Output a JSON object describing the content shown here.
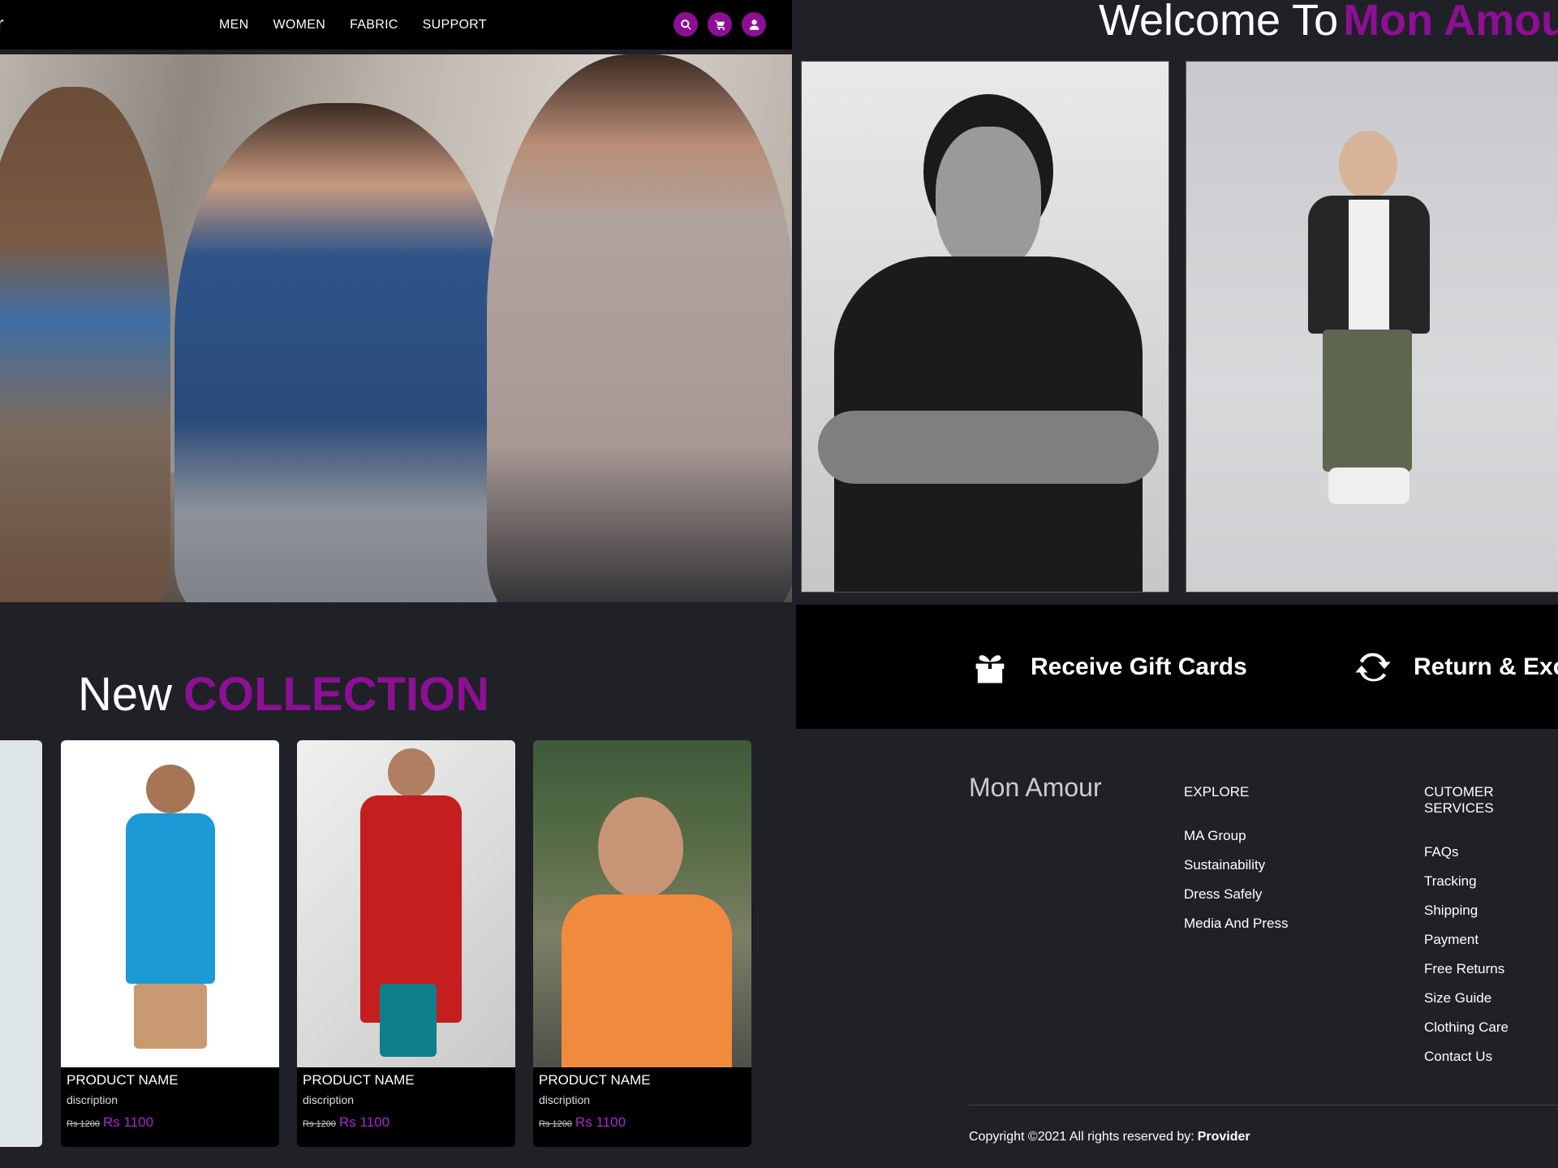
{
  "left": {
    "nav": {
      "logo_fragment": "r",
      "links": [
        "MEN",
        "WOMEN",
        "FABRIC",
        "SUPPORT"
      ],
      "icons": [
        "search-icon",
        "cart-icon",
        "user-icon"
      ],
      "accent_color": "#8c0f94"
    },
    "collection": {
      "title_thin": "New",
      "title_bold": "COLLECTION"
    },
    "products": [
      {
        "name": "PRODUCT NAME",
        "description": "discription",
        "old_price": "Rs 1200",
        "price": "Rs 1100"
      },
      {
        "name": "PRODUCT NAME",
        "description": "discription",
        "old_price": "Rs 1200",
        "price": "Rs 1100"
      },
      {
        "name": "PRODUCT NAME",
        "description": "discription",
        "old_price": "Rs 1200",
        "price": "Rs 1100"
      }
    ]
  },
  "right": {
    "welcome": {
      "thin": "Welcome To",
      "bold": "Mon Amour"
    },
    "features": [
      {
        "icon": "gift-icon",
        "text": "Receive Gift Cards"
      },
      {
        "icon": "exchange-icon",
        "text": "Return & Exchange"
      }
    ],
    "footer": {
      "brand": "Mon Amour",
      "explore": {
        "title": "EXPLORE",
        "links": [
          "MA Group",
          "Sustainability",
          "Dress Safely",
          "Media And Press"
        ]
      },
      "customer_services": {
        "title": "CUTOMER SERVICES",
        "links": [
          "FAQs",
          "Tracking",
          "Shipping",
          "Payment",
          "Free Returns",
          "Size Guide",
          "Clothing Care",
          "Contact Us"
        ]
      },
      "copyright": "Copyright ©2021 All rights reserved by:",
      "provider": "Provider"
    }
  }
}
